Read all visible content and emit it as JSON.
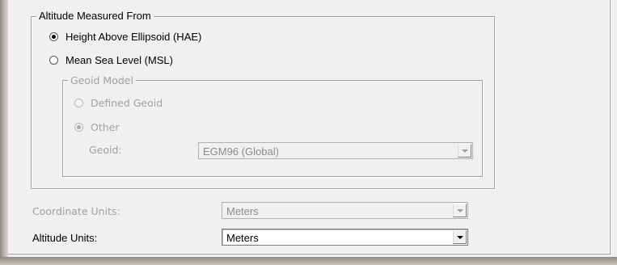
{
  "altitude_group": {
    "title": "Altitude Measured From",
    "option_hae": "Height Above Ellipsoid (HAE)",
    "option_msl": "Mean Sea Level (MSL)",
    "selected": "hae",
    "geoid_model": {
      "title": "Geoid Model",
      "option_defined": "Defined Geoid",
      "option_other": "Other",
      "selected": "other",
      "geoid_label": "Geoid:",
      "geoid_value": "EGM96 (Global)"
    }
  },
  "coordinate_units": {
    "label": "Coordinate Units:",
    "value": "Meters",
    "enabled": false
  },
  "altitude_units": {
    "label": "Altitude Units:",
    "value": "Meters",
    "enabled": true
  }
}
